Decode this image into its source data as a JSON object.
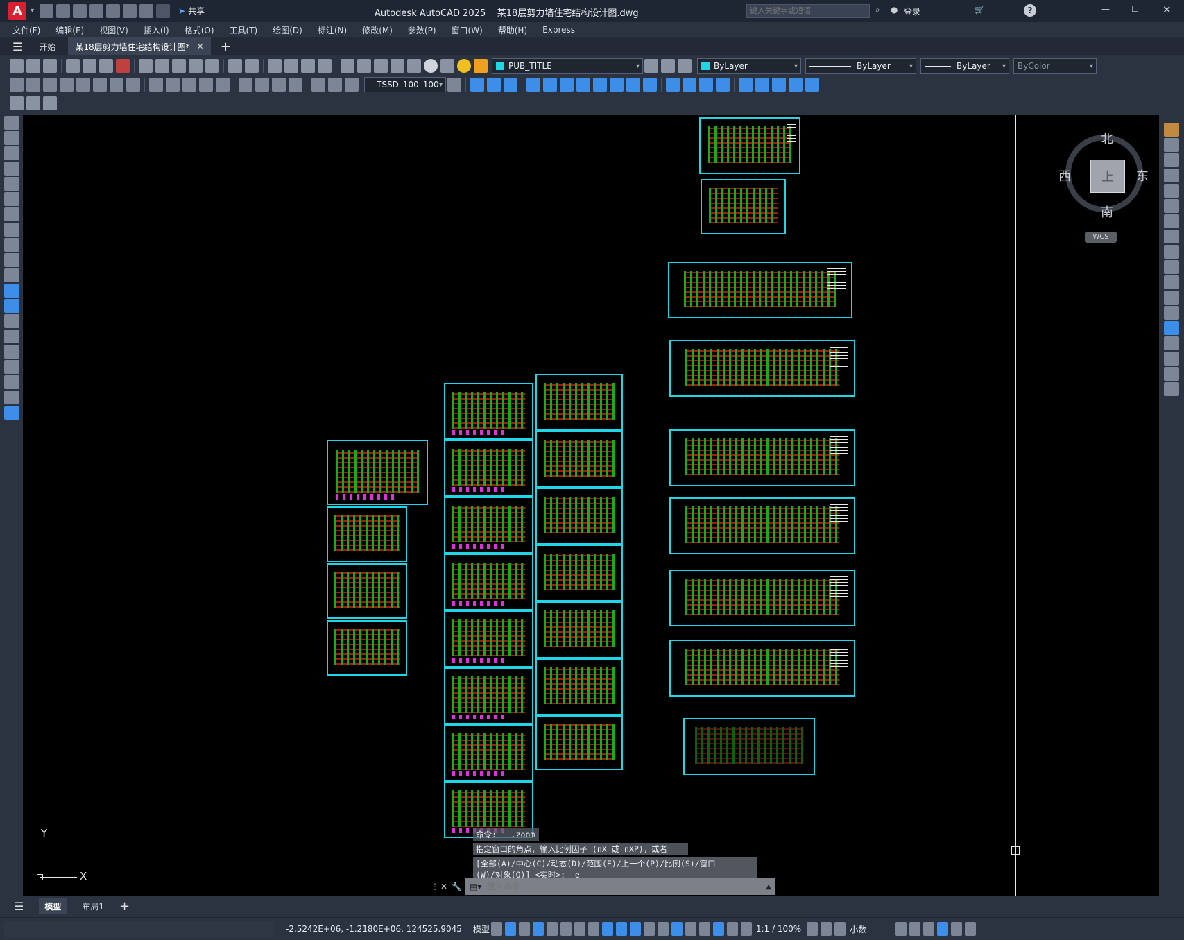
{
  "title": {
    "app": "Autodesk AutoCAD 2025",
    "file": "某18层剪力墙住宅结构设计图.dwg",
    "share": "共享",
    "search_placeholder": "键入关键字或短语",
    "login": "登录"
  },
  "menu": [
    "文件(F)",
    "编辑(E)",
    "视图(V)",
    "插入(I)",
    "格式(O)",
    "工具(T)",
    "绘图(D)",
    "标注(N)",
    "修改(M)",
    "参数(P)",
    "窗口(W)",
    "帮助(H)",
    "Express"
  ],
  "tabs": {
    "start": "开始",
    "doc": "某18层剪力墙住宅结构设计图*"
  },
  "props": {
    "layer": "PUB_TITLE",
    "color": "ByLayer",
    "linetype": "ByLayer",
    "lineweight": "ByLayer",
    "plotstyle": "ByColor",
    "dimstyle": "TSSD_100_100"
  },
  "viewcube": {
    "north": "北",
    "south": "南",
    "east": "东",
    "west": "西",
    "top": "上",
    "wcs": "WCS"
  },
  "ucs": {
    "x": "X",
    "y": "Y"
  },
  "command": {
    "line1": "命令: '_.zoom",
    "line2": "指定窗口的角点，输入比例因子 (nX 或 nXP)，或者",
    "line3": "[全部(A)/中心(C)/动态(D)/范围(E)/上一个(P)/比例(S)/窗口",
    "line4": "(W)/对象(O)] <实时>: _e",
    "placeholder": "键入命令"
  },
  "layout_tabs": {
    "model": "模型",
    "layout1": "布局1"
  },
  "status": {
    "coords": "-2.5242E+06, -1.2180E+06, 124525.9045",
    "model": "模型",
    "scale": "1:1 / 100%",
    "units": "小数"
  },
  "colors": {
    "accent": "#1fd6e6",
    "green": "#18c318",
    "red": "#dc1e1e",
    "magenta": "#e030e0"
  }
}
